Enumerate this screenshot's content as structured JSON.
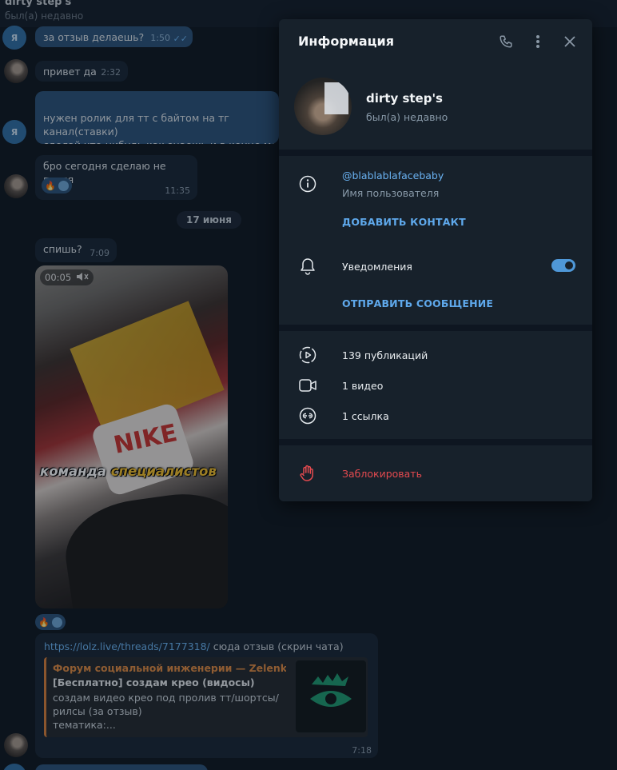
{
  "chat": {
    "header_name": "dirty step's",
    "header_status": "был(а) недавно",
    "avatar_letter": "Я",
    "date_divider": "17 июня",
    "messages": [
      {
        "text": "за отзыв делаешь?",
        "time": "1:50"
      },
      {
        "text": "привет да",
        "time": "2:32"
      },
      {
        "text": "нужен ролик для тт с байтом на тг канал(ставки)\nсделай что-нибудь как знаешь и в конце место\nпотом сам подставлю",
        "time": ""
      },
      {
        "text": "бро сегодня сделаю не парся",
        "time": "11:35"
      },
      {
        "text": "спишь?",
        "time": "7:09"
      }
    ],
    "video": {
      "duration": "00:05",
      "caption_part1": "команда",
      "caption_part2": "специалистов"
    },
    "link_message": {
      "url": "https://lolz.live/threads/7177318/",
      "text": "сюда отзыв (скрин чата)",
      "preview_site": "Форум социальной инженерии — Zelenka...",
      "preview_title": "[Бесплатно] создам крео (видосы)",
      "preview_desc": "создам видео крео под пролив тт/шортсы/\nрилсы (за отзыв)\nтематика:...",
      "time": "7:18"
    }
  },
  "panel": {
    "title": "Информация",
    "profile_name": "dirty step's",
    "profile_status": "был(а) недавно",
    "username": "@blablablafacebaby",
    "username_label": "Имя пользователя",
    "add_contact": "ДОБАВИТЬ КОНТАКТ",
    "notifications_label": "Уведомления",
    "notifications_on": true,
    "send_message": "ОТПРАВИТЬ СООБЩЕНИЕ",
    "media": [
      {
        "label": "139 публикаций",
        "icon": "stories-icon"
      },
      {
        "label": "1 видео",
        "icon": "video-icon"
      },
      {
        "label": "1 ссылка",
        "icon": "link-icon"
      }
    ],
    "block": "Заблокировать"
  },
  "colors": {
    "panel_bg": "#17212b",
    "accent": "#5fa9ec",
    "danger": "#e44a4f",
    "outgoing_bubble": "#2b5278"
  }
}
